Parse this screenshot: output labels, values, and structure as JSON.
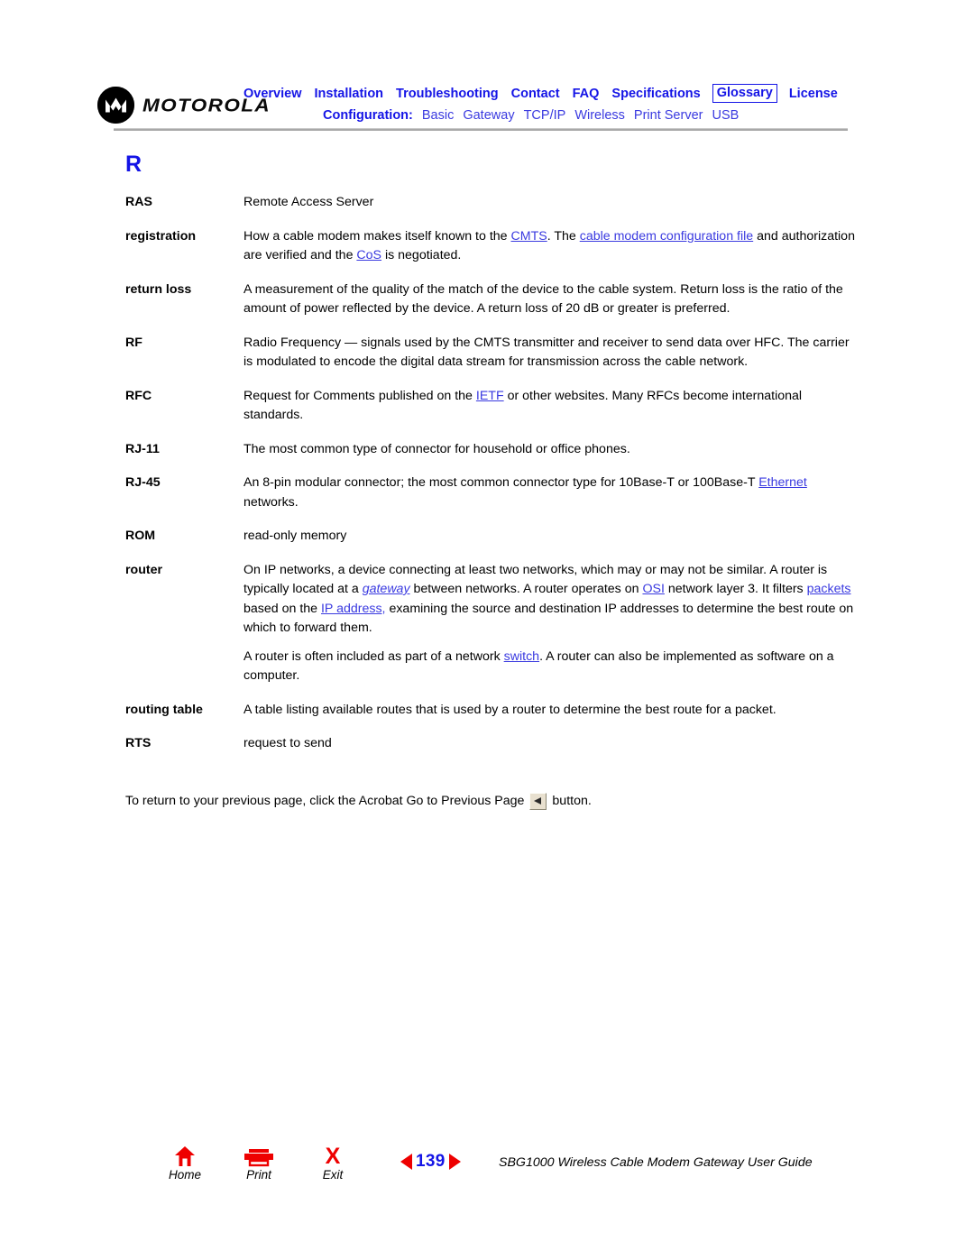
{
  "header": {
    "logo_text": "MOTOROLA",
    "logo_icon": "motorola-batwing-icon",
    "nav_primary": [
      {
        "label": "Overview",
        "current": false
      },
      {
        "label": "Installation",
        "current": false
      },
      {
        "label": "Troubleshooting",
        "current": false
      },
      {
        "label": "Contact",
        "current": false
      },
      {
        "label": "FAQ",
        "current": false
      },
      {
        "label": "Specifications",
        "current": false
      },
      {
        "label": "Glossary",
        "current": true
      },
      {
        "label": "License",
        "current": false
      }
    ],
    "configuration_label": "Configuration:",
    "nav_configuration": [
      {
        "label": "Basic"
      },
      {
        "label": "Gateway"
      },
      {
        "label": "TCP/IP"
      },
      {
        "label": "Wireless"
      },
      {
        "label": "Print Server"
      },
      {
        "label": "USB"
      }
    ]
  },
  "content": {
    "letter_heading": "R",
    "entries": [
      {
        "term": "RAS",
        "paragraphs": [
          [
            {
              "t": "Remote Access Server",
              "s": "plain"
            }
          ]
        ]
      },
      {
        "term": "registration",
        "paragraphs": [
          [
            {
              "t": "How a cable modem makes itself known to the ",
              "s": "plain"
            },
            {
              "t": "CMTS",
              "s": "link"
            },
            {
              "t": ". The ",
              "s": "plain"
            },
            {
              "t": "cable modem configuration file",
              "s": "link"
            },
            {
              "t": " and authorization are verified and the ",
              "s": "plain"
            },
            {
              "t": "CoS",
              "s": "link"
            },
            {
              "t": " is negotiated.",
              "s": "plain"
            }
          ]
        ]
      },
      {
        "term": "return loss",
        "paragraphs": [
          [
            {
              "t": "A measurement of the quality of the match of the device to the cable system. Return loss is the ratio of the amount of power reflected by the device. A return loss of 20 dB or greater is preferred.",
              "s": "plain"
            }
          ]
        ]
      },
      {
        "term": "RF",
        "paragraphs": [
          [
            {
              "t": "Radio Frequency — signals used by the CMTS transmitter and receiver to send data over HFC. The carrier is modulated to encode the digital data stream for transmission across the cable network.",
              "s": "plain"
            }
          ]
        ]
      },
      {
        "term": "RFC",
        "paragraphs": [
          [
            {
              "t": "Request for Comments published on the ",
              "s": "plain"
            },
            {
              "t": "IETF",
              "s": "link"
            },
            {
              "t": " or other websites. Many RFCs become international standards.",
              "s": "plain"
            }
          ]
        ]
      },
      {
        "term": "RJ-11",
        "paragraphs": [
          [
            {
              "t": "The most common type of connector for household or office phones.",
              "s": "plain"
            }
          ]
        ]
      },
      {
        "term": "RJ-45",
        "paragraphs": [
          [
            {
              "t": "An 8-pin modular connector; the most common connector type for 10Base-T or 100Base-T ",
              "s": "plain"
            },
            {
              "t": "Ethernet",
              "s": "link"
            },
            {
              "t": " networks.",
              "s": "plain"
            }
          ]
        ]
      },
      {
        "term": "ROM",
        "paragraphs": [
          [
            {
              "t": "read-only memory",
              "s": "plain"
            }
          ]
        ]
      },
      {
        "term": "router",
        "paragraphs": [
          [
            {
              "t": "On IP networks, a device connecting at least two networks, which may or may not be similar. A router is typically located at a ",
              "s": "plain"
            },
            {
              "t": "gateway",
              "s": "link-italic"
            },
            {
              "t": " between networks. A router operates on ",
              "s": "plain"
            },
            {
              "t": "OSI",
              "s": "link"
            },
            {
              "t": " network layer 3. It filters ",
              "s": "plain"
            },
            {
              "t": "packets",
              "s": "link"
            },
            {
              "t": " based on the ",
              "s": "plain"
            },
            {
              "t": "IP address,",
              "s": "link"
            },
            {
              "t": " examining the source and destination IP addresses to determine the best route on which to forward them.",
              "s": "plain"
            }
          ],
          [
            {
              "t": "A router is often included as part of a network ",
              "s": "plain"
            },
            {
              "t": "switch",
              "s": "link"
            },
            {
              "t": ". A router can also be implemented as software on a computer.",
              "s": "plain"
            }
          ]
        ]
      },
      {
        "term": "routing table",
        "paragraphs": [
          [
            {
              "t": "A table listing available routes that is used by a router to determine the best route for a packet.",
              "s": "plain"
            }
          ]
        ]
      },
      {
        "term": "RTS",
        "paragraphs": [
          [
            {
              "t": "request to send",
              "s": "plain"
            }
          ]
        ]
      }
    ],
    "closing_note_before": "To return to your previous page, click the Acrobat Go to Previous Page",
    "closing_note_icon": "acrobat-go-to-previous-page-icon",
    "closing_note_after": "button."
  },
  "footer": {
    "buttons": [
      {
        "label": "Home",
        "icon": "home-icon"
      },
      {
        "label": "Print",
        "icon": "printer-icon"
      },
      {
        "label": "Exit",
        "icon": "exit-x-icon"
      }
    ],
    "prev_icon": "previous-page-triangle-icon",
    "next_icon": "next-page-triangle-icon",
    "page_number": "139",
    "guide_title": "SBG1000 Wireless Cable Modem Gateway User Guide"
  },
  "colors": {
    "link_blue": "#3a3ae0",
    "nav_blue": "#1414e6",
    "accent_red": "#ee0000",
    "rule_gray": "#a8a8a8"
  }
}
